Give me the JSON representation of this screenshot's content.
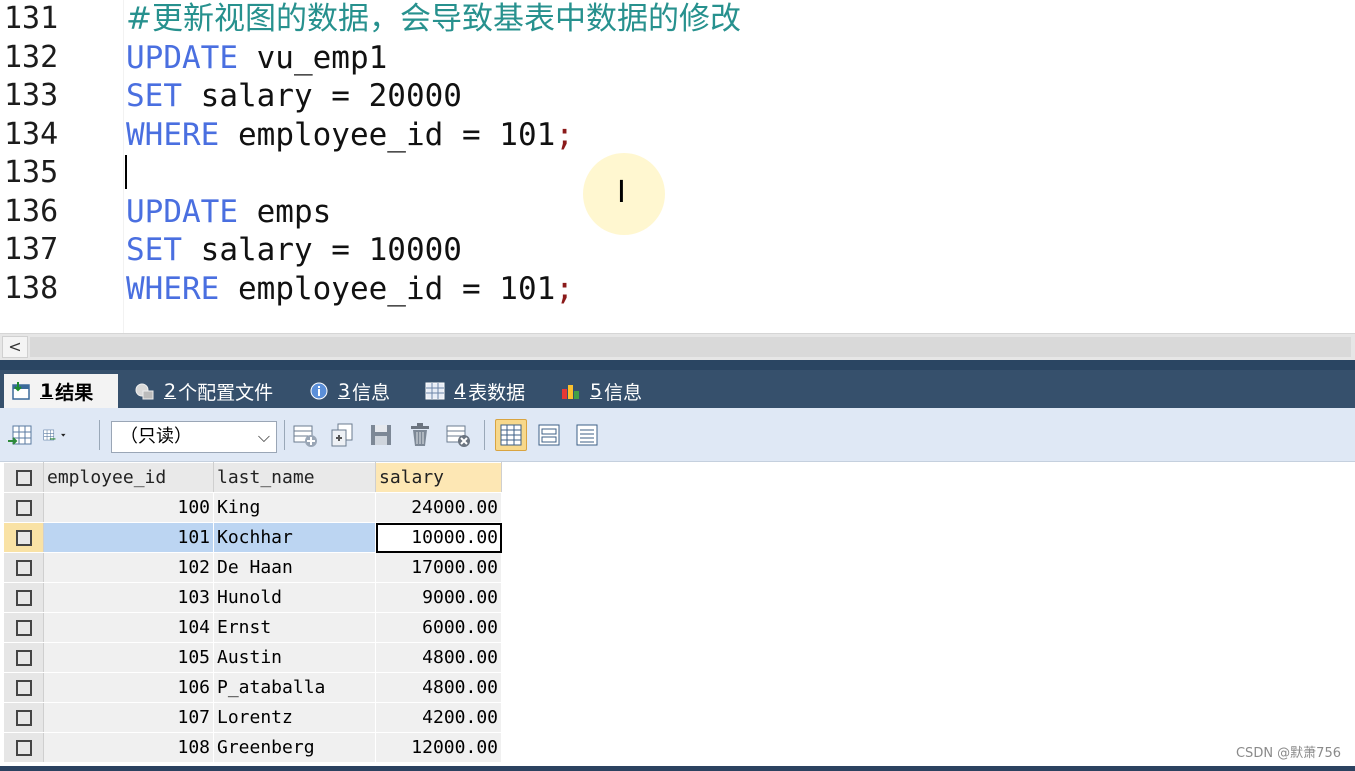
{
  "editor": {
    "lines": [
      {
        "num": "131",
        "parts": [
          {
            "t": "#更新视图的数据，会导致基表中数据的修改",
            "c": "cmt"
          }
        ]
      },
      {
        "num": "132",
        "parts": [
          {
            "t": "UPDATE",
            "c": "kw"
          },
          {
            "t": " vu_emp1",
            "c": ""
          }
        ]
      },
      {
        "num": "133",
        "parts": [
          {
            "t": "SET",
            "c": "kw"
          },
          {
            "t": " salary = 20000",
            "c": ""
          }
        ]
      },
      {
        "num": "134",
        "parts": [
          {
            "t": "WHERE",
            "c": "kw"
          },
          {
            "t": " employee_id = 101",
            "c": ""
          },
          {
            "t": ";",
            "c": "semi"
          }
        ]
      },
      {
        "num": "135",
        "parts": []
      },
      {
        "num": "136",
        "parts": [
          {
            "t": "UPDATE",
            "c": "kw"
          },
          {
            "t": " emps",
            "c": ""
          }
        ]
      },
      {
        "num": "137",
        "parts": [
          {
            "t": "SET",
            "c": "kw"
          },
          {
            "t": " salary = 10000",
            "c": ""
          }
        ]
      },
      {
        "num": "138",
        "parts": [
          {
            "t": "WHERE",
            "c": "kw"
          },
          {
            "t": " employee_id = 101",
            "c": ""
          },
          {
            "t": ";",
            "c": "semi"
          }
        ]
      }
    ],
    "cursor_glyph": "I"
  },
  "scrollbar": {
    "left_arrow": "<"
  },
  "tabs": [
    {
      "num": "1",
      "label": "结果",
      "icon": "result-icon",
      "active": true
    },
    {
      "num": "2",
      "label": "个配置文件",
      "icon": "profile-icon",
      "active": false
    },
    {
      "num": "3",
      "label": "信息",
      "icon": "info-icon",
      "active": false
    },
    {
      "num": "4",
      "label": "表数据",
      "icon": "table-data-icon",
      "active": false
    },
    {
      "num": "5",
      "label": "信息",
      "icon": "info-chart-icon",
      "active": false
    }
  ],
  "toolbar": {
    "mode_value": "（只读）",
    "mode_arrow": "⌵"
  },
  "grid": {
    "columns": [
      "employee_id",
      "last_name",
      "salary"
    ],
    "rows": [
      [
        "100",
        "King",
        "24000.00"
      ],
      [
        "101",
        "Kochhar",
        "10000.00"
      ],
      [
        "102",
        "De Haan",
        "17000.00"
      ],
      [
        "103",
        "Hunold",
        "9000.00"
      ],
      [
        "104",
        "Ernst",
        "6000.00"
      ],
      [
        "105",
        "Austin",
        "4800.00"
      ],
      [
        "106",
        "P_ataballa",
        "4800.00"
      ],
      [
        "107",
        "Lorentz",
        "4200.00"
      ],
      [
        "108",
        "Greenberg",
        "12000.00"
      ]
    ],
    "selected_row_index": 1
  },
  "watermark": "CSDN @默萧756",
  "colors": {
    "keyword": "#4a6fe0",
    "comment": "#27918e",
    "tabbar": "#36506c",
    "toolbar": "#dfe8f5",
    "selection": "#bcd5f2"
  }
}
